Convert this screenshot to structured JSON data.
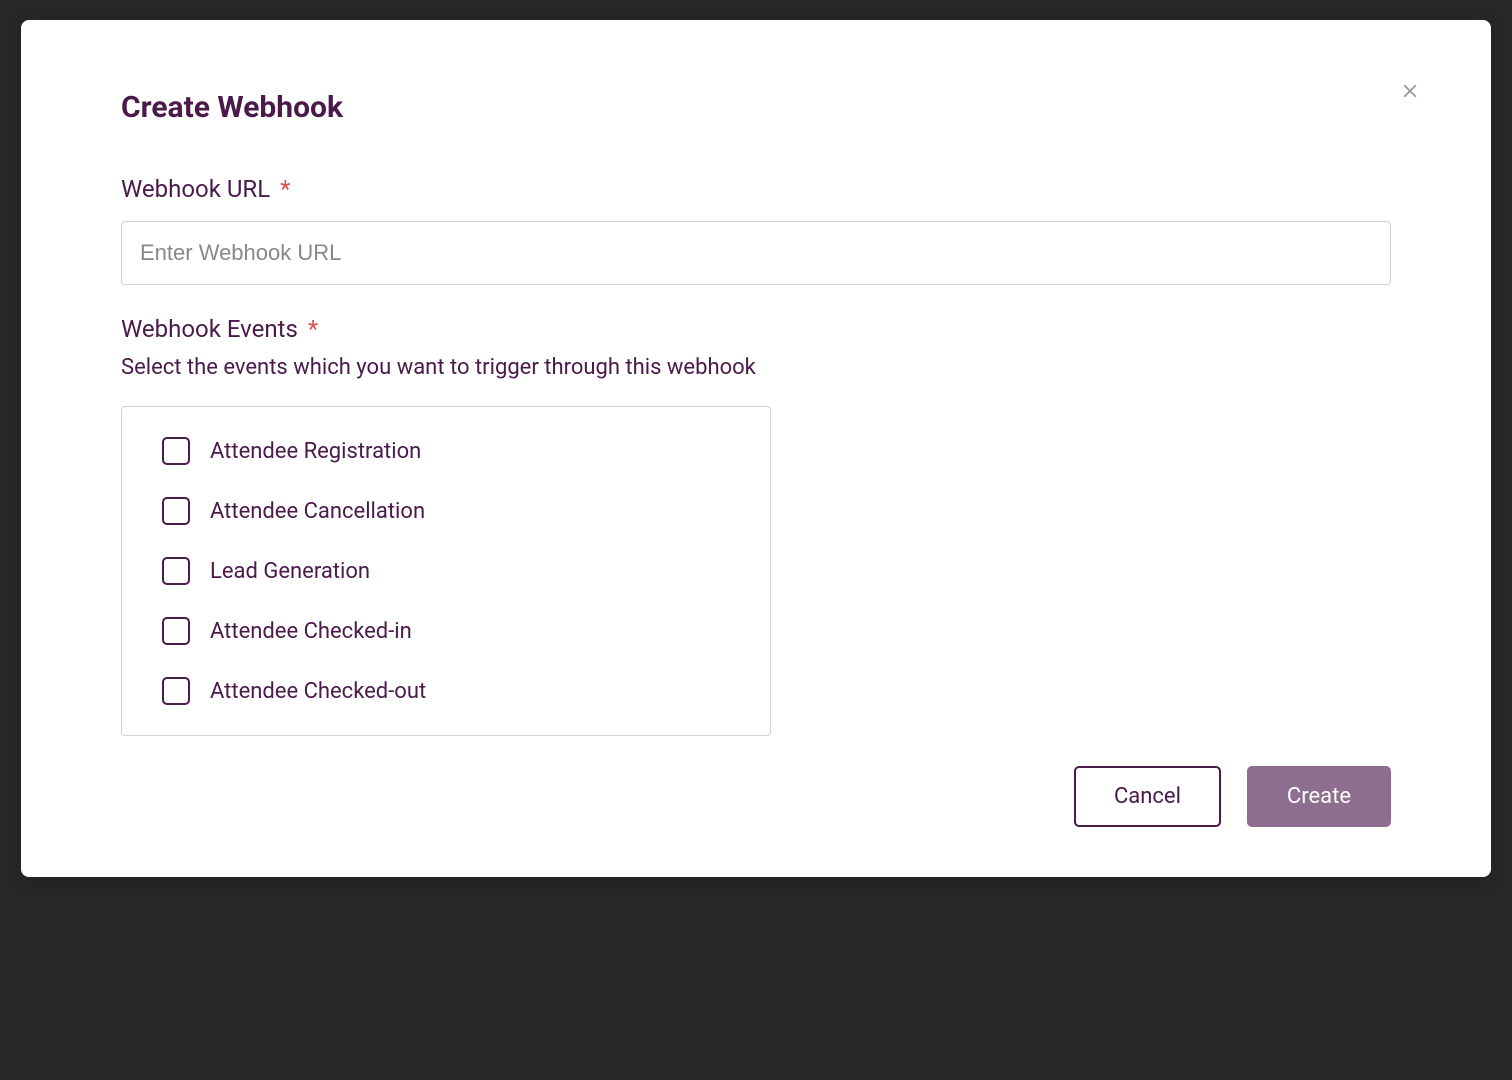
{
  "modal": {
    "title": "Create Webhook",
    "url_field": {
      "label": "Webhook URL",
      "required_marker": "*",
      "placeholder": "Enter Webhook URL",
      "value": ""
    },
    "events_field": {
      "label": "Webhook Events",
      "required_marker": "*",
      "description": "Select the events which you want to trigger through this webhook",
      "options": [
        {
          "label": "Attendee Registration",
          "checked": false
        },
        {
          "label": "Attendee Cancellation",
          "checked": false
        },
        {
          "label": "Lead Generation",
          "checked": false
        },
        {
          "label": "Attendee Checked-in",
          "checked": false
        },
        {
          "label": "Attendee Checked-out",
          "checked": false
        }
      ]
    },
    "buttons": {
      "cancel": "Cancel",
      "create": "Create"
    }
  }
}
